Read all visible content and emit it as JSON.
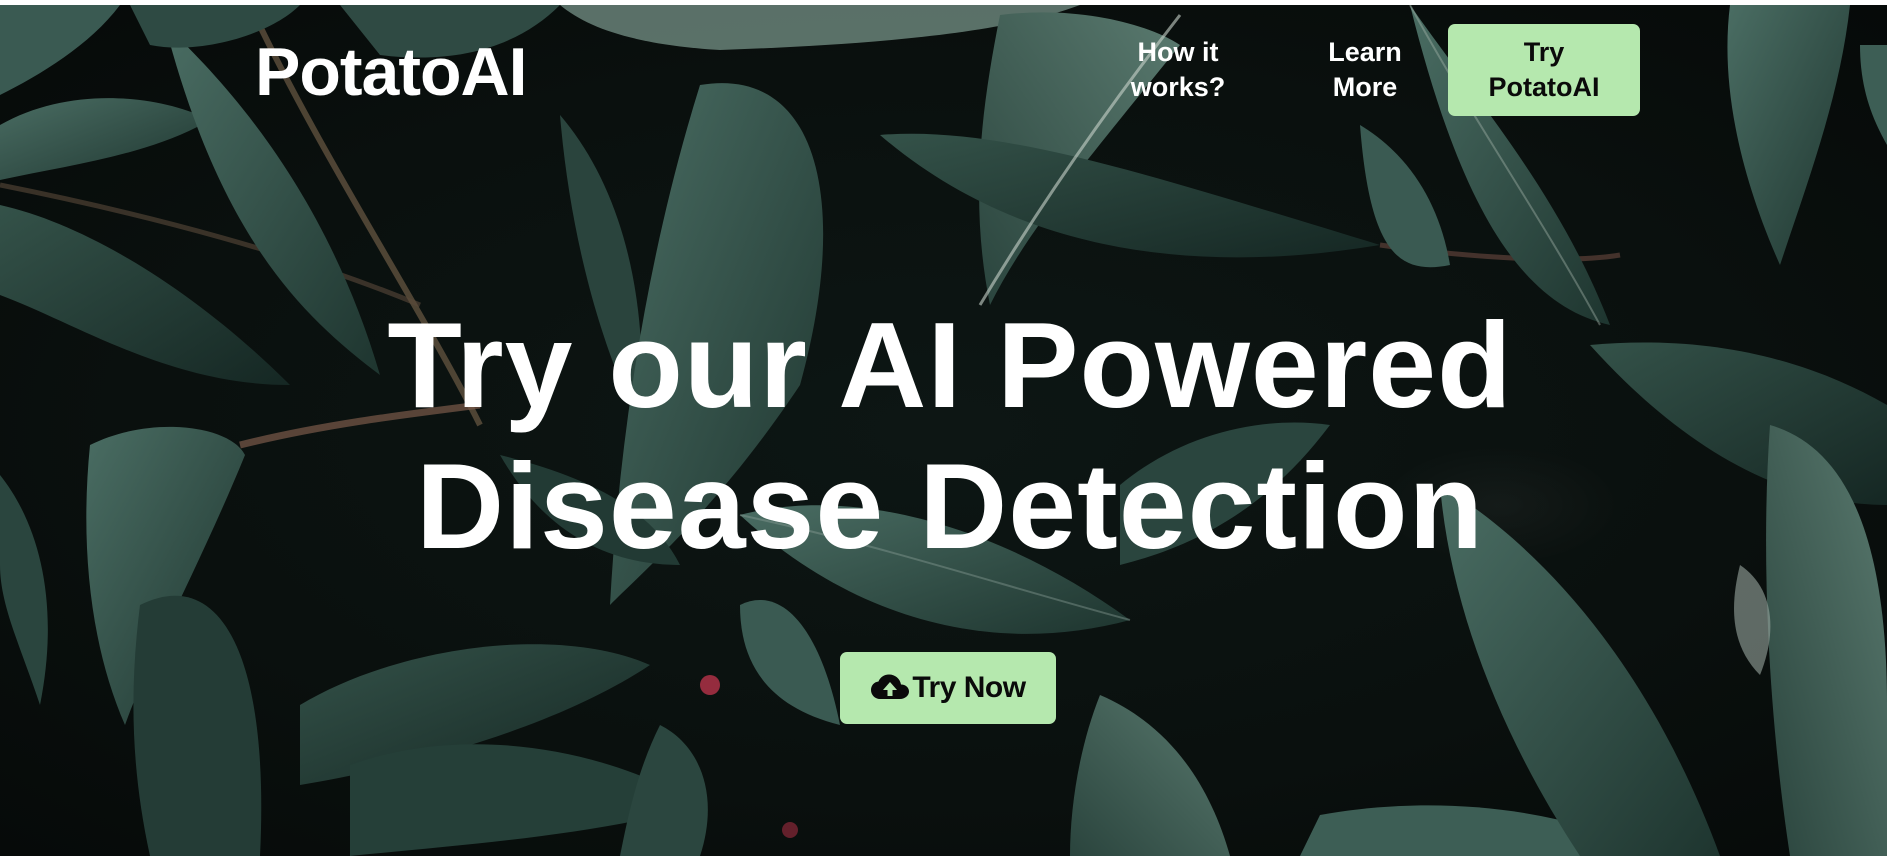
{
  "brand": {
    "logo_text": "PotatoAI"
  },
  "nav": {
    "how_label": "How it works?",
    "learn_label": "Learn More",
    "try_label": "Try PotatoAI"
  },
  "hero": {
    "headline": "Try our AI Powered Disease Detection",
    "cta_label": "Try Now",
    "cta_icon": "cloud-upload-icon",
    "background": "dark green leaves photo with water droplets"
  },
  "colors": {
    "accent": "#b5e8ae",
    "text_light": "#ffffff",
    "text_dark": "#0a0a0a",
    "leaf_dark": "#1f3a33",
    "leaf_mid": "#3d5e55"
  }
}
